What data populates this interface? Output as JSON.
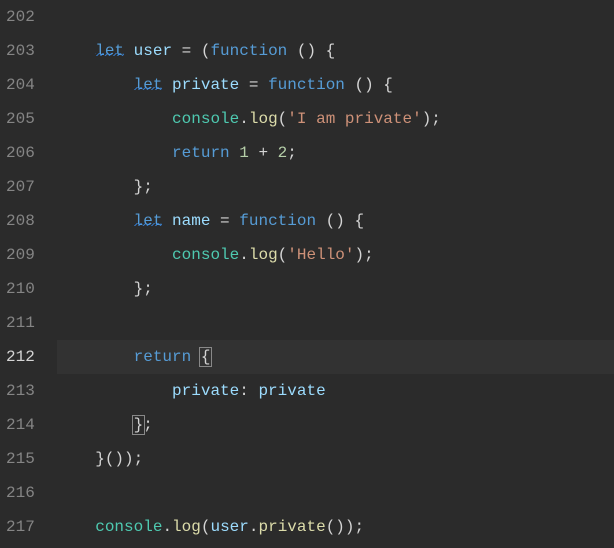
{
  "gutter": {
    "start": 202,
    "end": 217,
    "active": 212
  },
  "code": {
    "l202": "",
    "l203": {
      "indent": "    ",
      "let": "let",
      "user": "user",
      "eq": " = (",
      "func": "function",
      "rest": " () {"
    },
    "l204": {
      "indent": "        ",
      "let": "let",
      "priv": "private",
      "eq": " = ",
      "func": "function",
      "rest": " () {"
    },
    "l205": {
      "indent": "            ",
      "console": "console",
      "dot": ".",
      "log": "log",
      "open": "(",
      "str": "'I am private'",
      "close": ");"
    },
    "l206": {
      "indent": "            ",
      "ret": "return",
      "sp": " ",
      "n1": "1",
      "plus": " + ",
      "n2": "2",
      "semi": ";"
    },
    "l207": {
      "indent": "        ",
      "close": "};"
    },
    "l208": {
      "indent": "        ",
      "let": "let",
      "name": "name",
      "eq": " = ",
      "func": "function",
      "rest": " () {"
    },
    "l209": {
      "indent": "            ",
      "console": "console",
      "dot": ".",
      "log": "log",
      "open": "(",
      "str": "'Hello'",
      "close": ");"
    },
    "l210": {
      "indent": "        ",
      "close": "};"
    },
    "l211": "",
    "l212": {
      "indent": "        ",
      "ret": "return",
      "sp": " ",
      "brace": "{"
    },
    "l213": {
      "indent": "            ",
      "key": "private",
      "colon": ": ",
      "val": "private"
    },
    "l214": {
      "indent": "        ",
      "brace": "}",
      "semi": ";"
    },
    "l215": {
      "indent": "    ",
      "close": "}());"
    },
    "l216": "",
    "l217": {
      "indent": "    ",
      "console": "console",
      "dot": ".",
      "log": "log",
      "open": "(",
      "user": "user",
      "dot2": ".",
      "priv": "private",
      "call": "());"
    }
  }
}
